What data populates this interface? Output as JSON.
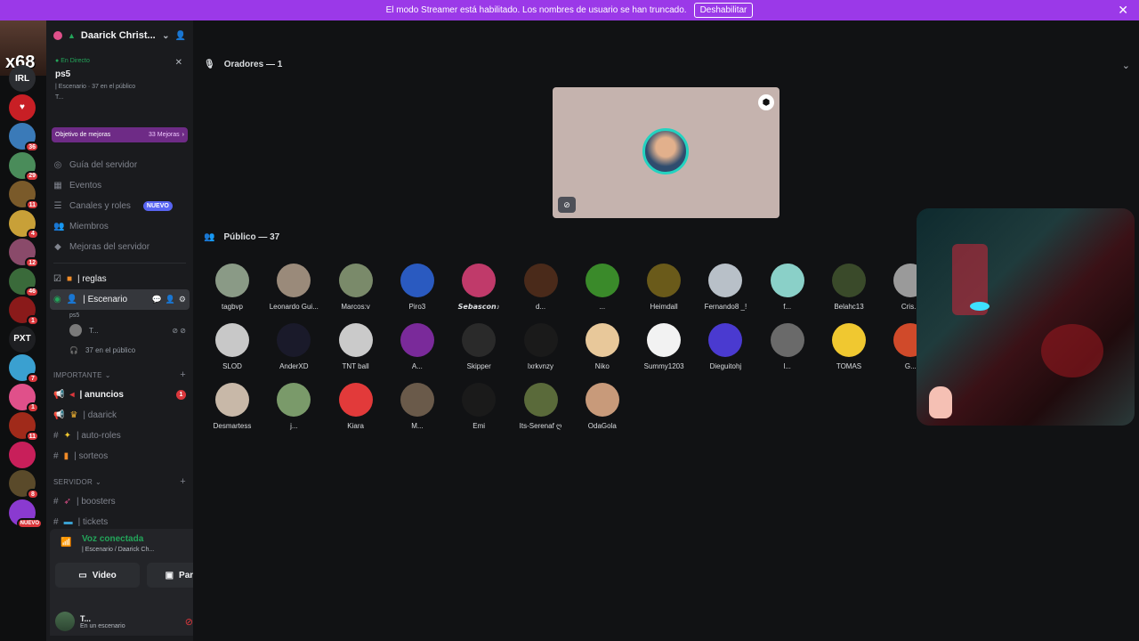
{
  "banner": {
    "text": "El modo Streamer está habilitado. Los nombres de usuario se han truncado.",
    "button": "Deshabilitar"
  },
  "rail": {
    "top_label": "x68",
    "items": [
      {
        "label": "IRL",
        "color": "#2b2d31",
        "badge": ""
      },
      {
        "label": "♥",
        "color": "#c81f25",
        "badge": ""
      },
      {
        "label": "",
        "color": "#3a7ab8",
        "badge": "36"
      },
      {
        "label": "",
        "color": "#4a8c5a",
        "badge": "29"
      },
      {
        "label": "",
        "color": "#7a5a2a",
        "badge": "11"
      },
      {
        "label": "",
        "color": "#c8a038",
        "badge": "4"
      },
      {
        "label": "",
        "color": "#8a4a6a",
        "badge": "12"
      },
      {
        "label": "",
        "color": "#3a6a3a",
        "badge": "46"
      },
      {
        "label": "",
        "color": "#8a1a1a",
        "badge": "1"
      },
      {
        "label": "PXT",
        "color": "#1e1f22",
        "badge": ""
      },
      {
        "label": "",
        "color": "#3aa0d0",
        "badge": "7"
      },
      {
        "label": "",
        "color": "#e0508a",
        "badge": "1"
      },
      {
        "label": "",
        "color": "#a02a1a",
        "badge": "11"
      },
      {
        "label": "",
        "color": "#c81f5a",
        "badge": ""
      },
      {
        "label": "",
        "color": "#5a4a2a",
        "badge": "8"
      },
      {
        "label": "",
        "color": "#8a3ad0",
        "badge": "NUEVO"
      }
    ]
  },
  "server": {
    "name": "Daarick Christ...",
    "live_label": "En Directo",
    "live_title": "ps5",
    "live_meta": "| Escenario · 37 en el público",
    "live_user": "T...",
    "goal_label": "Objetivo de mejoras",
    "goal_count": "33 Mejoras"
  },
  "nav": [
    {
      "label": "Guía del servidor",
      "icon": "guide-icon",
      "glyph": "◎",
      "badge": ""
    },
    {
      "label": "Eventos",
      "icon": "calendar-icon",
      "glyph": "▦",
      "badge": ""
    },
    {
      "label": "Canales y roles",
      "icon": "channels-roles-icon",
      "glyph": "☰",
      "badge": "NUEVO"
    },
    {
      "label": "Miembros",
      "icon": "members-icon",
      "glyph": "👥",
      "badge": ""
    },
    {
      "label": "Mejoras del servidor",
      "icon": "boost-icon",
      "glyph": "◆",
      "badge": ""
    }
  ],
  "channels": {
    "reglas": "| reglas",
    "escenario": "| Escenario",
    "escenario_sub": "ps5",
    "stage_user": "T...",
    "stage_audience": "37 en el público",
    "cat_importante": "IMPORTANTE",
    "anuncios": "| anuncios",
    "daarick": "| daarick",
    "autoroles": "| auto-roles",
    "sorteos": "| sorteos",
    "cat_servidor": "SERVIDOR",
    "boosters": "| boosters",
    "tickets": "| tickets",
    "anuncios_unread": "1"
  },
  "voice": {
    "status": "Voz conectada",
    "sub": "| Escenario / Daarick Ch...",
    "video_label": "Video",
    "screen_label": "Pantalla"
  },
  "user": {
    "name": "T...",
    "status": "En un escenario"
  },
  "stage": {
    "speakers_label": "Oradores — 1",
    "audience_label": "Público — 37"
  },
  "audience": [
    {
      "name": "tagbvp",
      "color": "#8a9a86"
    },
    {
      "name": "Leonardo Gui...",
      "color": "#9a8a7a"
    },
    {
      "name": "Marcos:v",
      "color": "#7a8a6a"
    },
    {
      "name": "Piro3",
      "color": "#2a5ac0"
    },
    {
      "name": "𝙎𝙚𝙗𝙖𝙨𝙘𝙤𝙣♪",
      "color": "#c03a6a"
    },
    {
      "name": "d...",
      "color": "#4a2a1a"
    },
    {
      "name": "...",
      "color": "#3a8a2a"
    },
    {
      "name": "Heimdall",
      "color": "#6a5a1a"
    },
    {
      "name": "Fernando8 _!",
      "color": "#b8c0c8"
    },
    {
      "name": "f...",
      "color": "#8ad0c8"
    },
    {
      "name": "Belahc13",
      "color": "#3a4a2a"
    },
    {
      "name": "Cris...",
      "color": "#9a9a9a"
    },
    {
      "name": "SLOD",
      "color": "#c8c8c8"
    },
    {
      "name": "AnderXD",
      "color": "#1a1a2a"
    },
    {
      "name": "TNT ball",
      "color": "#cacaca"
    },
    {
      "name": "A...",
      "color": "#7a2a9a"
    },
    {
      "name": "Skipper",
      "color": "#2a2a2a"
    },
    {
      "name": "lxrkvnzy",
      "color": "#1a1a1a"
    },
    {
      "name": "Niko",
      "color": "#e8c89a"
    },
    {
      "name": "Summy1203",
      "color": "#f2f2f2"
    },
    {
      "name": "Dieguitohj",
      "color": "#4a3ad0"
    },
    {
      "name": "l...",
      "color": "#6a6a6a"
    },
    {
      "name": "TOMAS",
      "color": "#f0c830"
    },
    {
      "name": "G...",
      "color": "#d04a2a"
    },
    {
      "name": "Desmartess",
      "color": "#c8b8a8"
    },
    {
      "name": "j...",
      "color": "#7a9a6a"
    },
    {
      "name": "Kiara",
      "color": "#e23a3a"
    },
    {
      "name": "M...",
      "color": "#6a5a4a"
    },
    {
      "name": "Emi",
      "color": "#1a1a1a"
    },
    {
      "name": "Its-Serenaf ღ",
      "color": "#5a6a3a"
    },
    {
      "name": "OdaGola",
      "color": "#c89a7a"
    }
  ]
}
